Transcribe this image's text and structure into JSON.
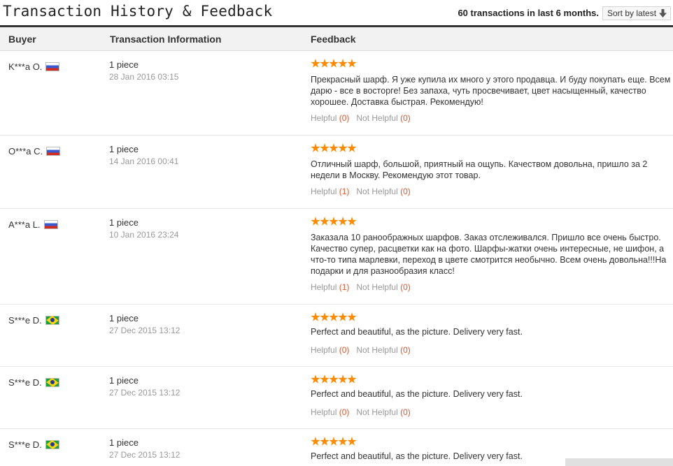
{
  "header": {
    "title": "Transaction History & Feedback",
    "summary": "60 transactions in last 6 months.",
    "sort_label": "Sort by latest"
  },
  "columns": {
    "buyer": "Buyer",
    "transaction": "Transaction Information",
    "feedback": "Feedback"
  },
  "helpful_label": "Helpful",
  "not_helpful_label": "Not Helpful",
  "colors": {
    "star": "#ff8a00",
    "count": "#e2552b",
    "header_bar": "#333333"
  },
  "rows": [
    {
      "buyer": "K***a O.",
      "flag": "ru-flag-icon",
      "quantity": "1 piece",
      "date": "28 Jan 2016 03:15",
      "rating": 5,
      "text": "Прекрасный шарф. Я уже купила их много у этого продавца. И буду покупать еще. Всем дарю - все в восторге! Без запаха, чуть просвечивает, цвет насыщенный, качество хорошее. Доставка быстрая. Рекомендую!",
      "helpful": "(0)",
      "not_helpful": "(0)"
    },
    {
      "buyer": "O***a C.",
      "flag": "ru-flag-icon",
      "quantity": "1 piece",
      "date": "14 Jan 2016 00:41",
      "rating": 5,
      "text": "Отличный шарф, большой, приятный на ощупь. Качеством довольна, пришло за 2 недели в Москву. Рекомендую этот товар.",
      "helpful": "(1)",
      "not_helpful": "(0)"
    },
    {
      "buyer": "A***a L.",
      "flag": "ru-flag-icon",
      "quantity": "1 piece",
      "date": "10 Jan 2016 23:24",
      "rating": 5,
      "text": "Заказала 10 раноображных шарфов. Заказ отслеживался. Пришло все очень быстро. Качество супер, расцветки как на фото. Шарфы-жатки очень интересные, не шифон, а что-то типа марлевки, переход в цвете смотрится необычно. Всем очень довольна!!!На подарки и для разнообразия класс!",
      "helpful": "(1)",
      "not_helpful": "(0)"
    },
    {
      "buyer": "S***e D.",
      "flag": "br-flag-icon",
      "quantity": "1 piece",
      "date": "27 Dec 2015 13:12",
      "rating": 5,
      "text": "Perfect and beautiful, as the picture. Delivery very fast.",
      "helpful": "(0)",
      "not_helpful": "(0)"
    },
    {
      "buyer": "S***e D.",
      "flag": "br-flag-icon",
      "quantity": "1 piece",
      "date": "27 Dec 2015 13:12",
      "rating": 5,
      "text": "Perfect and beautiful, as the picture. Delivery very fast.",
      "helpful": "(0)",
      "not_helpful": "(0)"
    },
    {
      "buyer": "S***e D.",
      "flag": "br-flag-icon",
      "quantity": "1 piece",
      "date": "27 Dec 2015 13:12",
      "rating": 5,
      "text": "Perfect and beautiful, as the picture. Delivery very fast."
    }
  ]
}
